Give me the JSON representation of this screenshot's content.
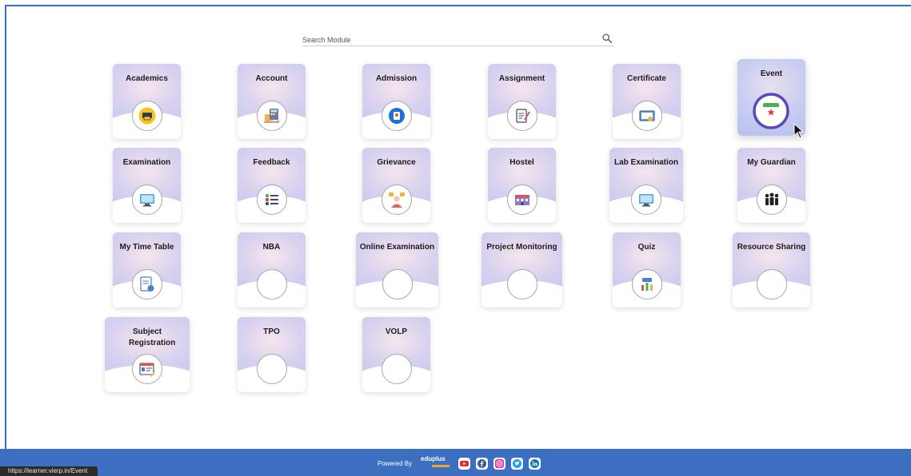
{
  "search": {
    "placeholder": "Search Module"
  },
  "modules": [
    {
      "label": "Academics",
      "icon": "printer-icon",
      "name": "academics"
    },
    {
      "label": "Account",
      "icon": "calculator-icon",
      "name": "account"
    },
    {
      "label": "Admission",
      "icon": "admission-icon",
      "name": "admission"
    },
    {
      "label": "Assignment",
      "icon": "clipboard-icon",
      "name": "assignment"
    },
    {
      "label": "Certificate",
      "icon": "certificate-icon",
      "name": "certificate"
    },
    {
      "label": "Event",
      "icon": "calendar-event-icon",
      "name": "event"
    },
    {
      "label": "Examination",
      "icon": "monitor-icon",
      "name": "examination"
    },
    {
      "label": "Feedback",
      "icon": "checklist-icon",
      "name": "feedback"
    },
    {
      "label": "Grievance",
      "icon": "person-speech-icon",
      "name": "grievance"
    },
    {
      "label": "Hostel",
      "icon": "building-icon",
      "name": "hostel"
    },
    {
      "label": "Lab Examination",
      "icon": "monitor-icon",
      "name": "lab-examination"
    },
    {
      "label": "My Guardian",
      "icon": "family-icon",
      "name": "my-guardian"
    },
    {
      "label": "My Time Table",
      "icon": "document-clock-icon",
      "name": "my-time-table"
    },
    {
      "label": "NBA",
      "icon": "",
      "name": "nba"
    },
    {
      "label": "Online Examination",
      "icon": "",
      "name": "online-examination"
    },
    {
      "label": "Project Monitoring",
      "icon": "",
      "name": "project-monitoring"
    },
    {
      "label": "Quiz",
      "icon": "quiz-icon",
      "name": "quiz"
    },
    {
      "label": "Resource Sharing",
      "icon": "",
      "name": "resource-sharing"
    },
    {
      "label": "Subject Registration",
      "icon": "registration-form-icon",
      "name": "subject-registration"
    },
    {
      "label": "TPO",
      "icon": "",
      "name": "tpo"
    },
    {
      "label": "VOLP",
      "icon": "",
      "name": "volp"
    }
  ],
  "footer": {
    "powered_by": "Powered By",
    "brand": "eduplus",
    "social": [
      "youtube-icon",
      "facebook-icon",
      "instagram-icon",
      "twitter-icon",
      "linkedin-icon"
    ]
  },
  "status_url": "https://learner.vierp.in/Event",
  "colors": {
    "footer": "#3d6fc0",
    "card_gradient": "#c2c9ee"
  }
}
